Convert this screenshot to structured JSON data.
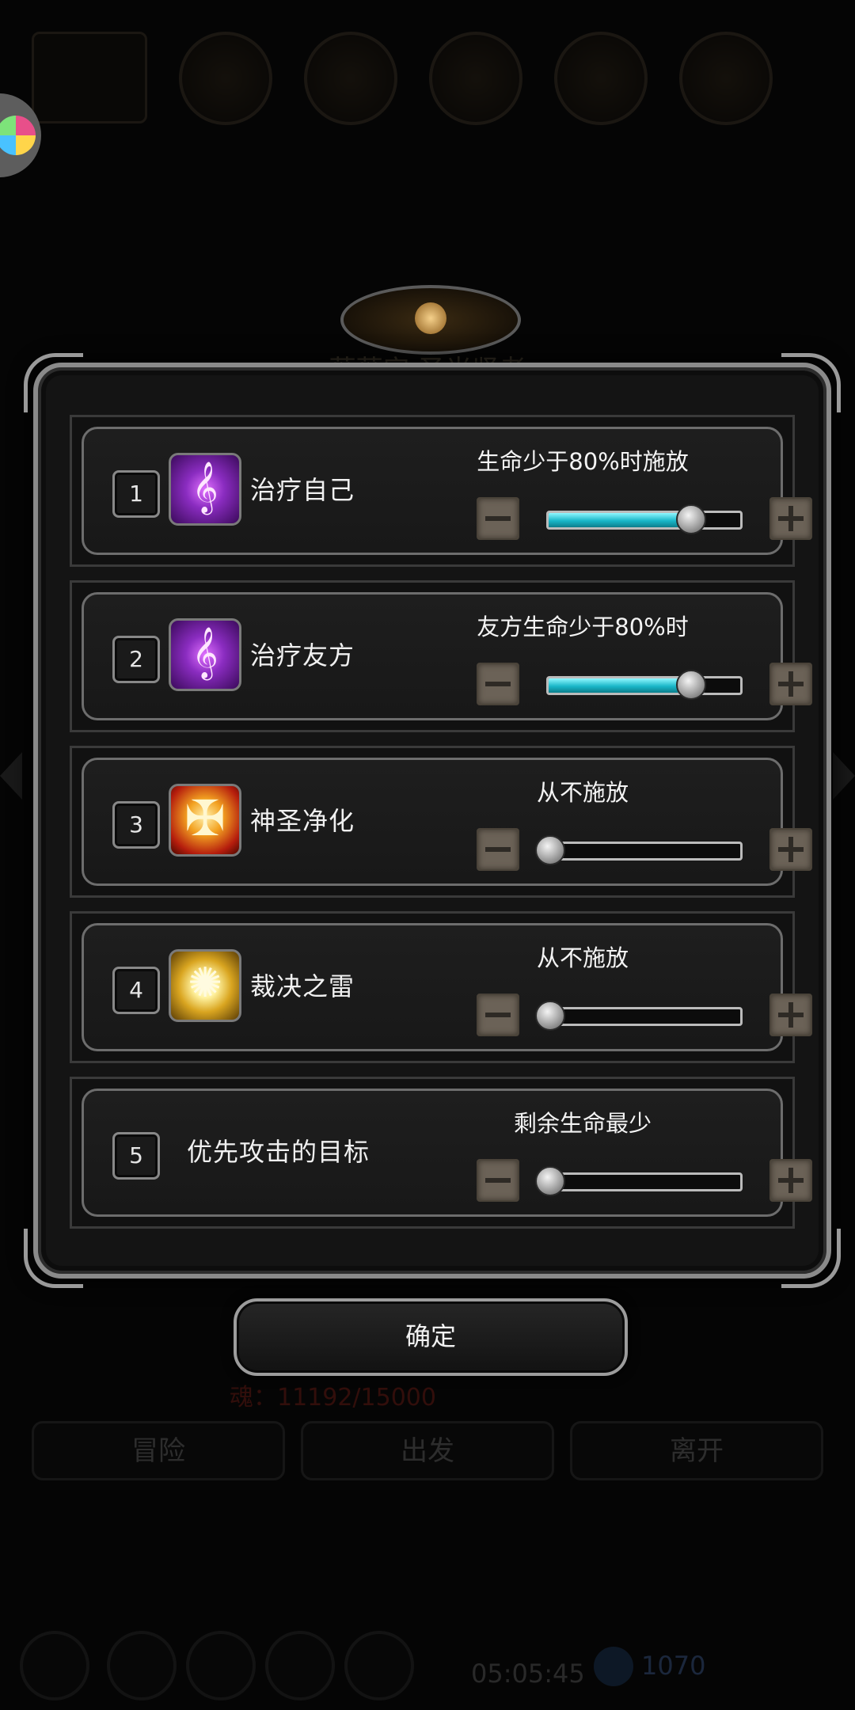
{
  "background": {
    "hero_name": "薇薇安 圣光贤者",
    "soul": "魂：11192/15000",
    "tabs": [
      "冒险",
      "出发",
      "离开"
    ],
    "clock": "05:05:45",
    "gem_count": "1070"
  },
  "rows": [
    {
      "index": "1",
      "name": "治疗自己",
      "icon": "heal-icon",
      "condition": "生命少于80%时施放",
      "level": 0.8
    },
    {
      "index": "2",
      "name": "治疗友方",
      "icon": "heal-icon",
      "condition": "友方生命少于80%时",
      "level": 0.8
    },
    {
      "index": "3",
      "name": "神圣净化",
      "icon": "holy-purify-icon",
      "condition": "从不施放",
      "level": 0
    },
    {
      "index": "4",
      "name": "裁决之雷",
      "icon": "thunder-icon",
      "condition": "从不施放",
      "level": 0
    },
    {
      "index": "5",
      "name": "优先攻击的目标",
      "icon": "",
      "condition": "剩余生命最少",
      "level": 0
    }
  ],
  "confirm_label": "确定",
  "colors": {
    "slider_fill": "#19b6c8",
    "dialog_border": "#8a8a8a",
    "soul_text": "#d03020"
  }
}
